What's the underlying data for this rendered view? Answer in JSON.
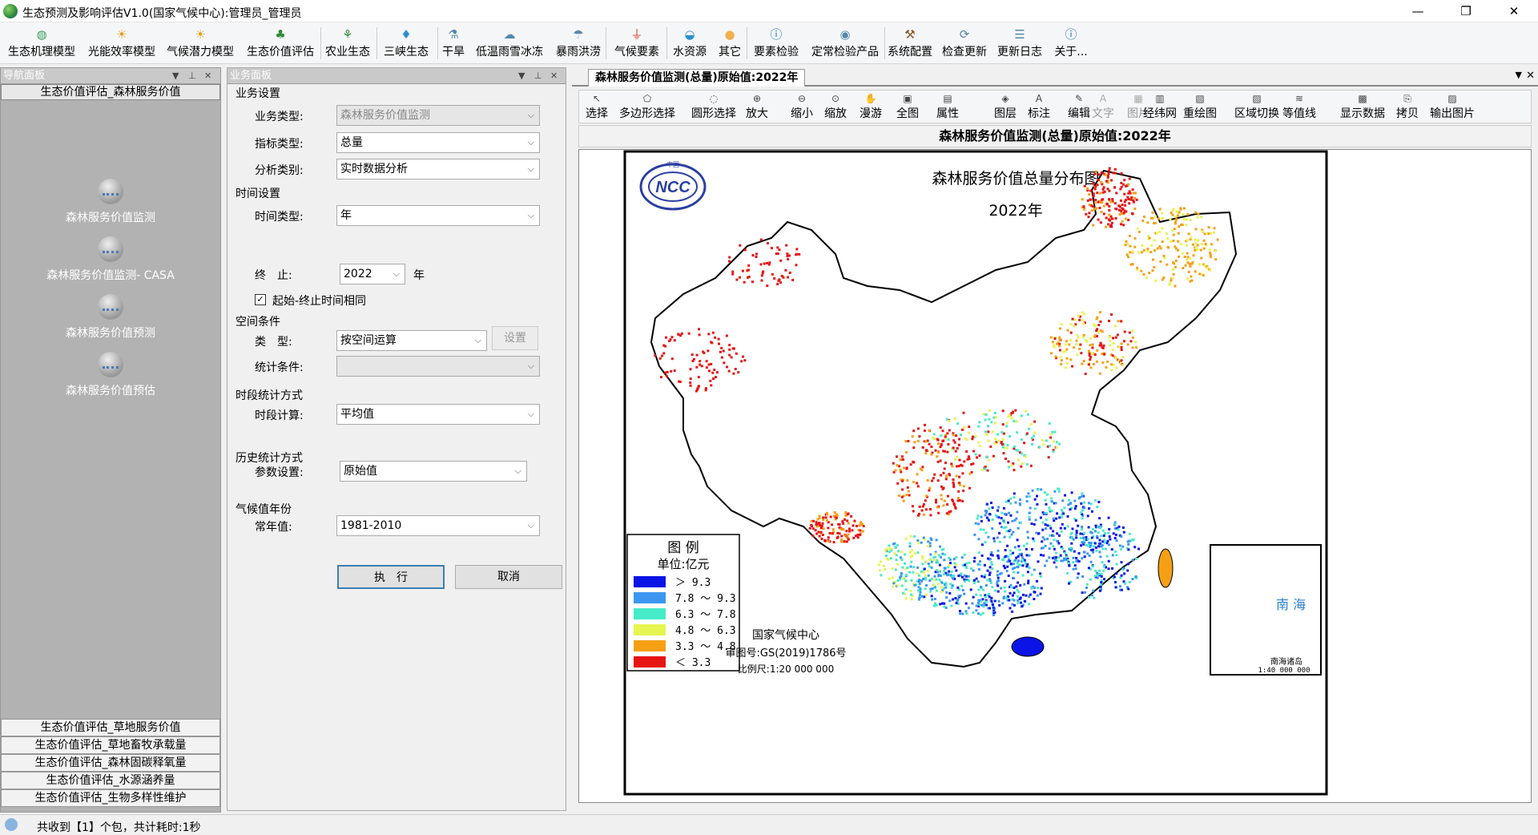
{
  "window": {
    "title": "生态预测及影响评估V1.0(国家气候中心):管理员_管理员",
    "controls": {
      "minimize": "—",
      "maximize": "❐",
      "close": "✕"
    }
  },
  "toolbar": {
    "items": [
      {
        "label": "生态机理模型",
        "icon": "leaf-globe-icon"
      },
      {
        "label": "光能效率模型",
        "icon": "sun-icon"
      },
      {
        "label": "气候潜力模型",
        "icon": "sun-icon"
      },
      {
        "label": "生态价值评估",
        "icon": "tree-icon"
      },
      {
        "label": "农业生态",
        "icon": "sprout-icon"
      },
      {
        "label": "三峡生态",
        "icon": "water-drop-icon"
      },
      {
        "label": "干旱",
        "icon": "dry-plant-icon"
      },
      {
        "label": "低温雨雪冰冻",
        "icon": "cloud-snow-icon"
      },
      {
        "label": "暴雨洪涝",
        "icon": "cloud-rain-icon"
      },
      {
        "label": "气候要素",
        "icon": "thermometer-icon"
      },
      {
        "label": "水资源",
        "icon": "water-icon"
      },
      {
        "label": "其它",
        "icon": "circle-icon"
      },
      {
        "label": "要素检验",
        "icon": "info-icon"
      },
      {
        "label": "定常检验产品",
        "icon": "check-globe-icon"
      },
      {
        "label": "系统配置",
        "icon": "hammer-icon"
      },
      {
        "label": "检查更新",
        "icon": "update-icon"
      },
      {
        "label": "更新日志",
        "icon": "log-icon"
      },
      {
        "label": "关于...",
        "icon": "info-icon"
      }
    ]
  },
  "nav_panel": {
    "title": "导航面板",
    "selected_group": "生态价值评估_森林服务价值",
    "items": [
      "森林服务价值监测",
      "森林服务价值监测- CASA",
      "森林服务价值预测",
      "森林服务价值预估"
    ],
    "footer_groups": [
      "生态价值评估_草地服务价值",
      "生态价值评估_草地畜牧承载量",
      "生态价值评估_森林固碳释氧量",
      "生态价值评估_水源涵养量",
      "生态价值评估_生物多样性维护"
    ]
  },
  "biz_panel": {
    "title": "业务面板",
    "sections": {
      "business": "业务设置",
      "time": "时间设置",
      "space": "空间条件",
      "period": "时段统计方式",
      "history": "历史统计方式",
      "climate": "气候值年份"
    },
    "labels": {
      "biz_type": "业务类型:",
      "index_type": "指标类型:",
      "analysis_type": "分析类别:",
      "time_type": "时间类型:",
      "end": "终　止:",
      "year_unit": "年",
      "space_type": "类　型:",
      "stat_cond": "统计条件:",
      "period_calc": "时段计算:",
      "param": "参数设置:",
      "normal": "常年值:"
    },
    "values": {
      "biz_type": "森林服务价值监测",
      "index_type": "总量",
      "analysis_type": "实时数据分析",
      "time_type": "年",
      "end_year": "2022",
      "same_time": "起始-终止时间相同",
      "space_type": "按空间运算",
      "stat_cond": "",
      "period_calc": "平均值",
      "param": "原始值",
      "normal": "1981-2010"
    },
    "buttons": {
      "settings": "设置",
      "execute": "执　行",
      "cancel": "取消"
    },
    "checkbox_checked": true
  },
  "map": {
    "tab": "森林服务价值监测(总量)原始值:2022年",
    "title": "森林服务价值监测(总量)原始值:2022年",
    "tools": [
      "选择",
      "多边形选择",
      "圆形选择",
      "放大",
      "缩小",
      "缩放",
      "漫游",
      "全图",
      "属性",
      "图层",
      "标注",
      "编辑",
      "文字",
      "图片",
      "经纬网",
      "重绘图",
      "区域切换",
      "等值线",
      "显示数据",
      "拷贝",
      "输出图片"
    ],
    "inner_title": "森林服务价值总量分布图",
    "year": "2022年",
    "logo_text": "NCC",
    "logo_arc": "中国",
    "legend": {
      "title": "图 例",
      "unit": "单位:亿元",
      "entries": [
        {
          "label": "＞ 9.3",
          "color": "#0a14e6"
        },
        {
          "label": "7.8 ～ 9.3",
          "color": "#3c96f0"
        },
        {
          "label": "6.3 ～ 7.8",
          "color": "#46ebc8"
        },
        {
          "label": "4.8 ～ 6.3",
          "color": "#e6f550"
        },
        {
          "label": "3.3 ～ 4.8",
          "color": "#f5a014"
        },
        {
          "label": "＜ 3.3",
          "color": "#e61414"
        }
      ]
    },
    "credits": [
      "国家气候中心",
      "审图号:GS(2019)1786号",
      "比例尺:1:20 000 000"
    ],
    "inset": {
      "sea": "南  海",
      "islands": "南海诸岛",
      "scale": "1:40 000 000"
    }
  },
  "status": {
    "text": "共收到【1】个包，共计耗时:1秒"
  }
}
